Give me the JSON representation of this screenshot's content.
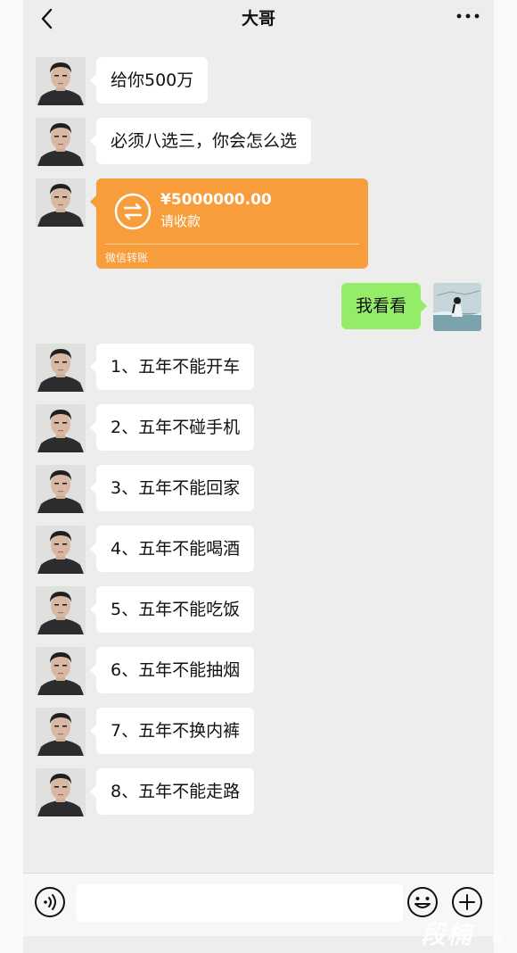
{
  "header": {
    "title": "大哥"
  },
  "icons": {
    "back": "chevron-left-icon",
    "more": "more-dots-icon",
    "transfer": "transfer-arrows-icon",
    "voice": "voice-icon",
    "emoji": "emoji-icon",
    "plus": "plus-icon"
  },
  "colors": {
    "transfer": "#f79d3b",
    "my_bubble": "#95ec69",
    "their_bubble": "#ffffff",
    "background": "#ededed"
  },
  "messages_before": [
    {
      "text": "给你500万"
    },
    {
      "text": "必须八选三，你会怎么选"
    }
  ],
  "transfer": {
    "amount": "¥5000000.00",
    "hint": "请收款",
    "label": "微信转账"
  },
  "my_message": {
    "text": "我看看"
  },
  "options": [
    {
      "text": "1、五年不能开车"
    },
    {
      "text": "2、五年不碰手机"
    },
    {
      "text": "3、五年不能回家"
    },
    {
      "text": "4、五年不能喝酒"
    },
    {
      "text": "5、五年不能吃饭"
    },
    {
      "text": "6、五年不能抽烟"
    },
    {
      "text": "7、五年不换内裤"
    },
    {
      "text": "8、五年不能走路"
    }
  ],
  "watermark": {
    "text": "段楠",
    "small": "吧"
  }
}
